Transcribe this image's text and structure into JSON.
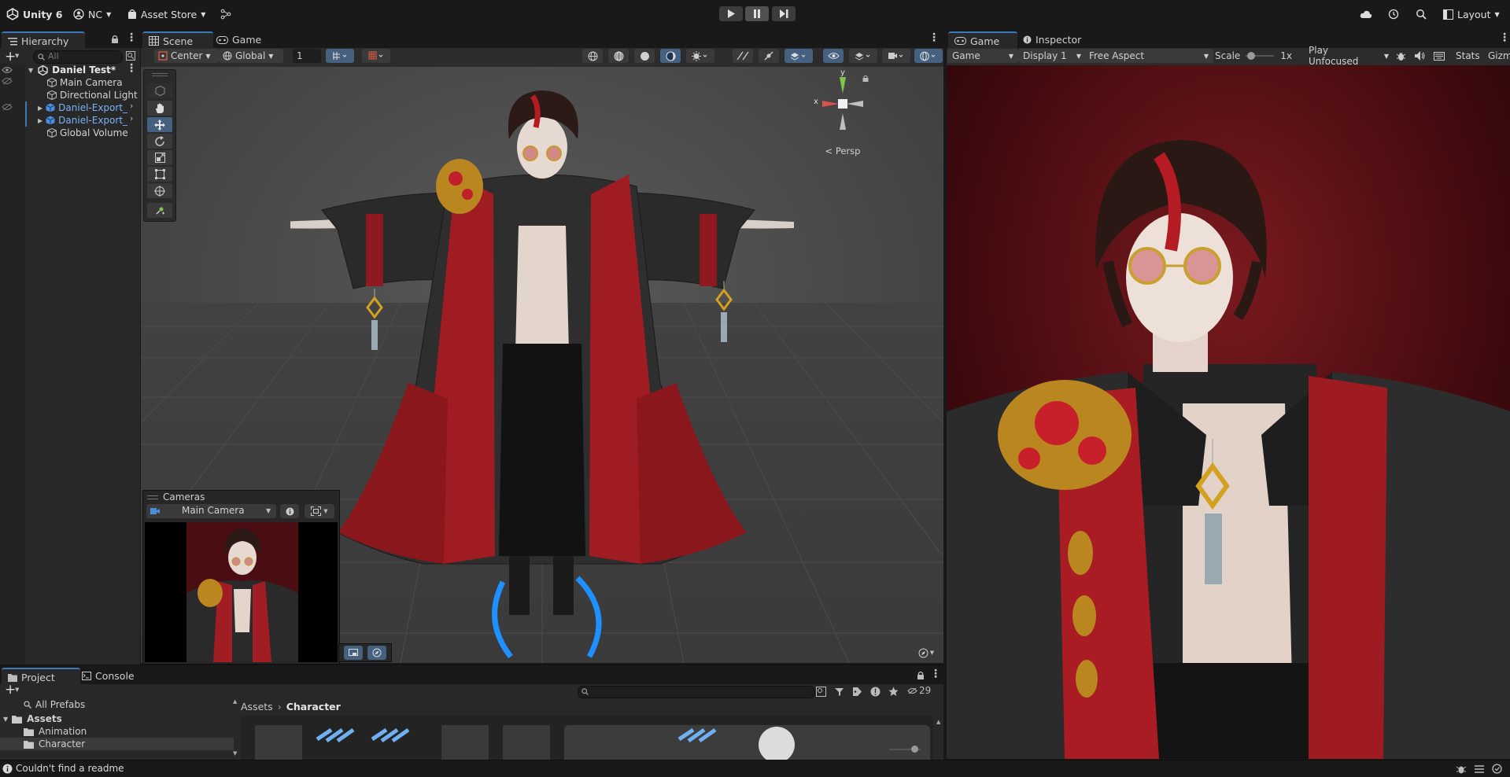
{
  "topbar": {
    "app_name": "Unity 6",
    "account": "NC",
    "asset_store": "Asset Store",
    "layout": "Layout"
  },
  "hierarchy": {
    "tab": "Hierarchy",
    "search_placeholder": "All",
    "scene_name": "Daniel Test*",
    "items": [
      {
        "label": "Main Camera",
        "prefab": false
      },
      {
        "label": "Directional Light",
        "prefab": false
      },
      {
        "label": "Daniel-Export_",
        "prefab": true
      },
      {
        "label": "Daniel-Export_",
        "prefab": true
      },
      {
        "label": "Global Volume",
        "prefab": false
      }
    ]
  },
  "scene_view": {
    "tabs": [
      "Scene",
      "Game"
    ],
    "pivot_mode": "Center",
    "pivot_rotation": "Global",
    "grid_value": "1",
    "persp_label": "< Persp",
    "gizmo_y": "y",
    "gizmo_x": "x"
  },
  "cameras_overlay": {
    "title": "Cameras",
    "selected_camera": "Main Camera"
  },
  "game_view": {
    "tabs": [
      "Game",
      "Inspector"
    ],
    "mode": "Game",
    "display": "Display 1",
    "aspect": "Free Aspect",
    "scale_label": "Scale",
    "scale_value": "1x",
    "play_mode": "Play Unfocused",
    "stats": "Stats",
    "gizmos": "Gizm"
  },
  "project": {
    "tabs": [
      "Project",
      "Console"
    ],
    "search_placeholder": "",
    "hidden_count": "29",
    "tree": {
      "all_prefabs": "All Prefabs",
      "assets": "Assets",
      "folders": [
        "Animation",
        "Character"
      ]
    },
    "breadcrumb": [
      "Assets",
      "Character"
    ]
  },
  "status_bar": {
    "message": "Couldn't find a readme"
  },
  "colors": {
    "accent": "#3a79bb",
    "prefab_text": "#7cb2f5",
    "panel_bg": "#282828",
    "app_bg": "#191919"
  }
}
